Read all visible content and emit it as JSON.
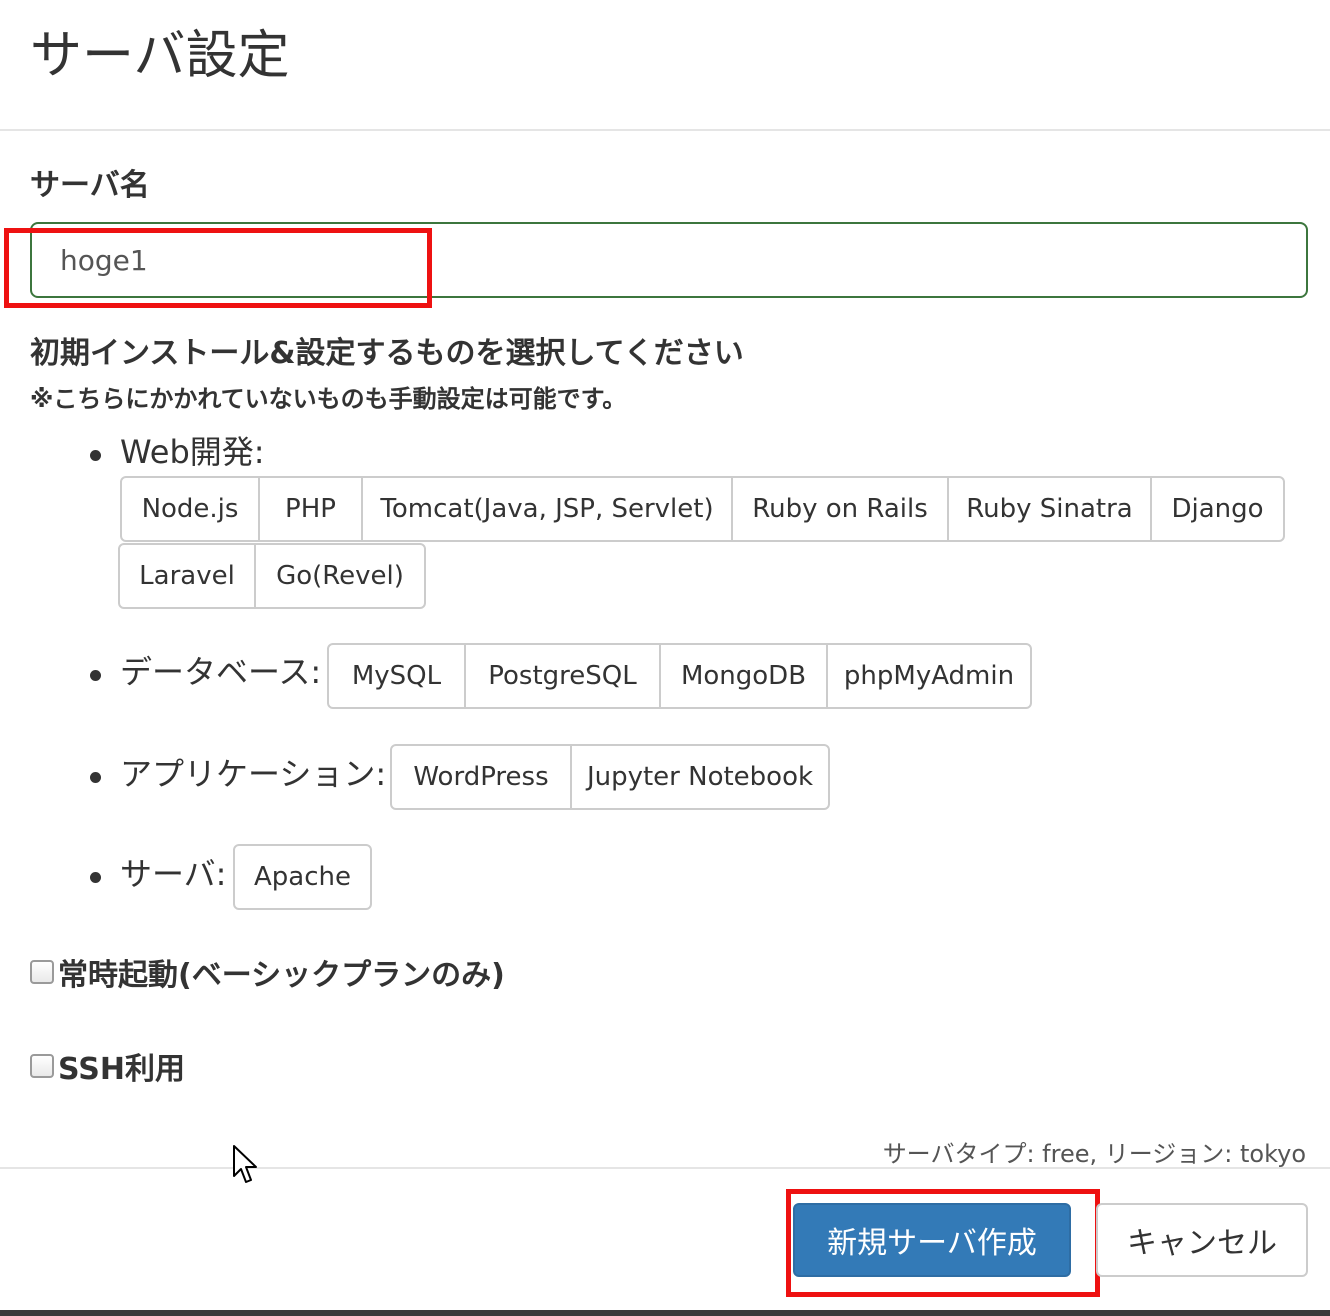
{
  "header": {
    "title": "サーバ設定"
  },
  "server_name": {
    "label": "サーバ名",
    "value": "hoge1"
  },
  "install": {
    "heading": "初期インストール&設定するものを選択してください",
    "note": "※こちらにかかれていないものも手動設定は可能です。",
    "categories": [
      {
        "label": "Web開発:",
        "options": [
          "Node.js",
          "PHP",
          "Tomcat(Java, JSP, Servlet)",
          "Ruby on Rails",
          "Ruby Sinatra",
          "Django",
          "Laravel",
          "Go(Revel)"
        ]
      },
      {
        "label": "データベース:",
        "options": [
          "MySQL",
          "PostgreSQL",
          "MongoDB",
          "phpMyAdmin"
        ]
      },
      {
        "label": "アプリケーション:",
        "options": [
          "WordPress",
          "Jupyter Notebook"
        ]
      },
      {
        "label": "サーバ:",
        "options": [
          "Apache"
        ]
      }
    ]
  },
  "options": {
    "always_on_label": "常時起動(ベーシックプランのみ)",
    "ssh_label": "SSH利用"
  },
  "meta": {
    "info": "サーバタイプ: free, リージョン: tokyo"
  },
  "footer": {
    "create_label": "新規サーバ作成",
    "cancel_label": "キャンセル"
  },
  "colors": {
    "primary": "#337ab7",
    "input_border_success": "#3c763d",
    "annotation_red": "#ee1111"
  }
}
